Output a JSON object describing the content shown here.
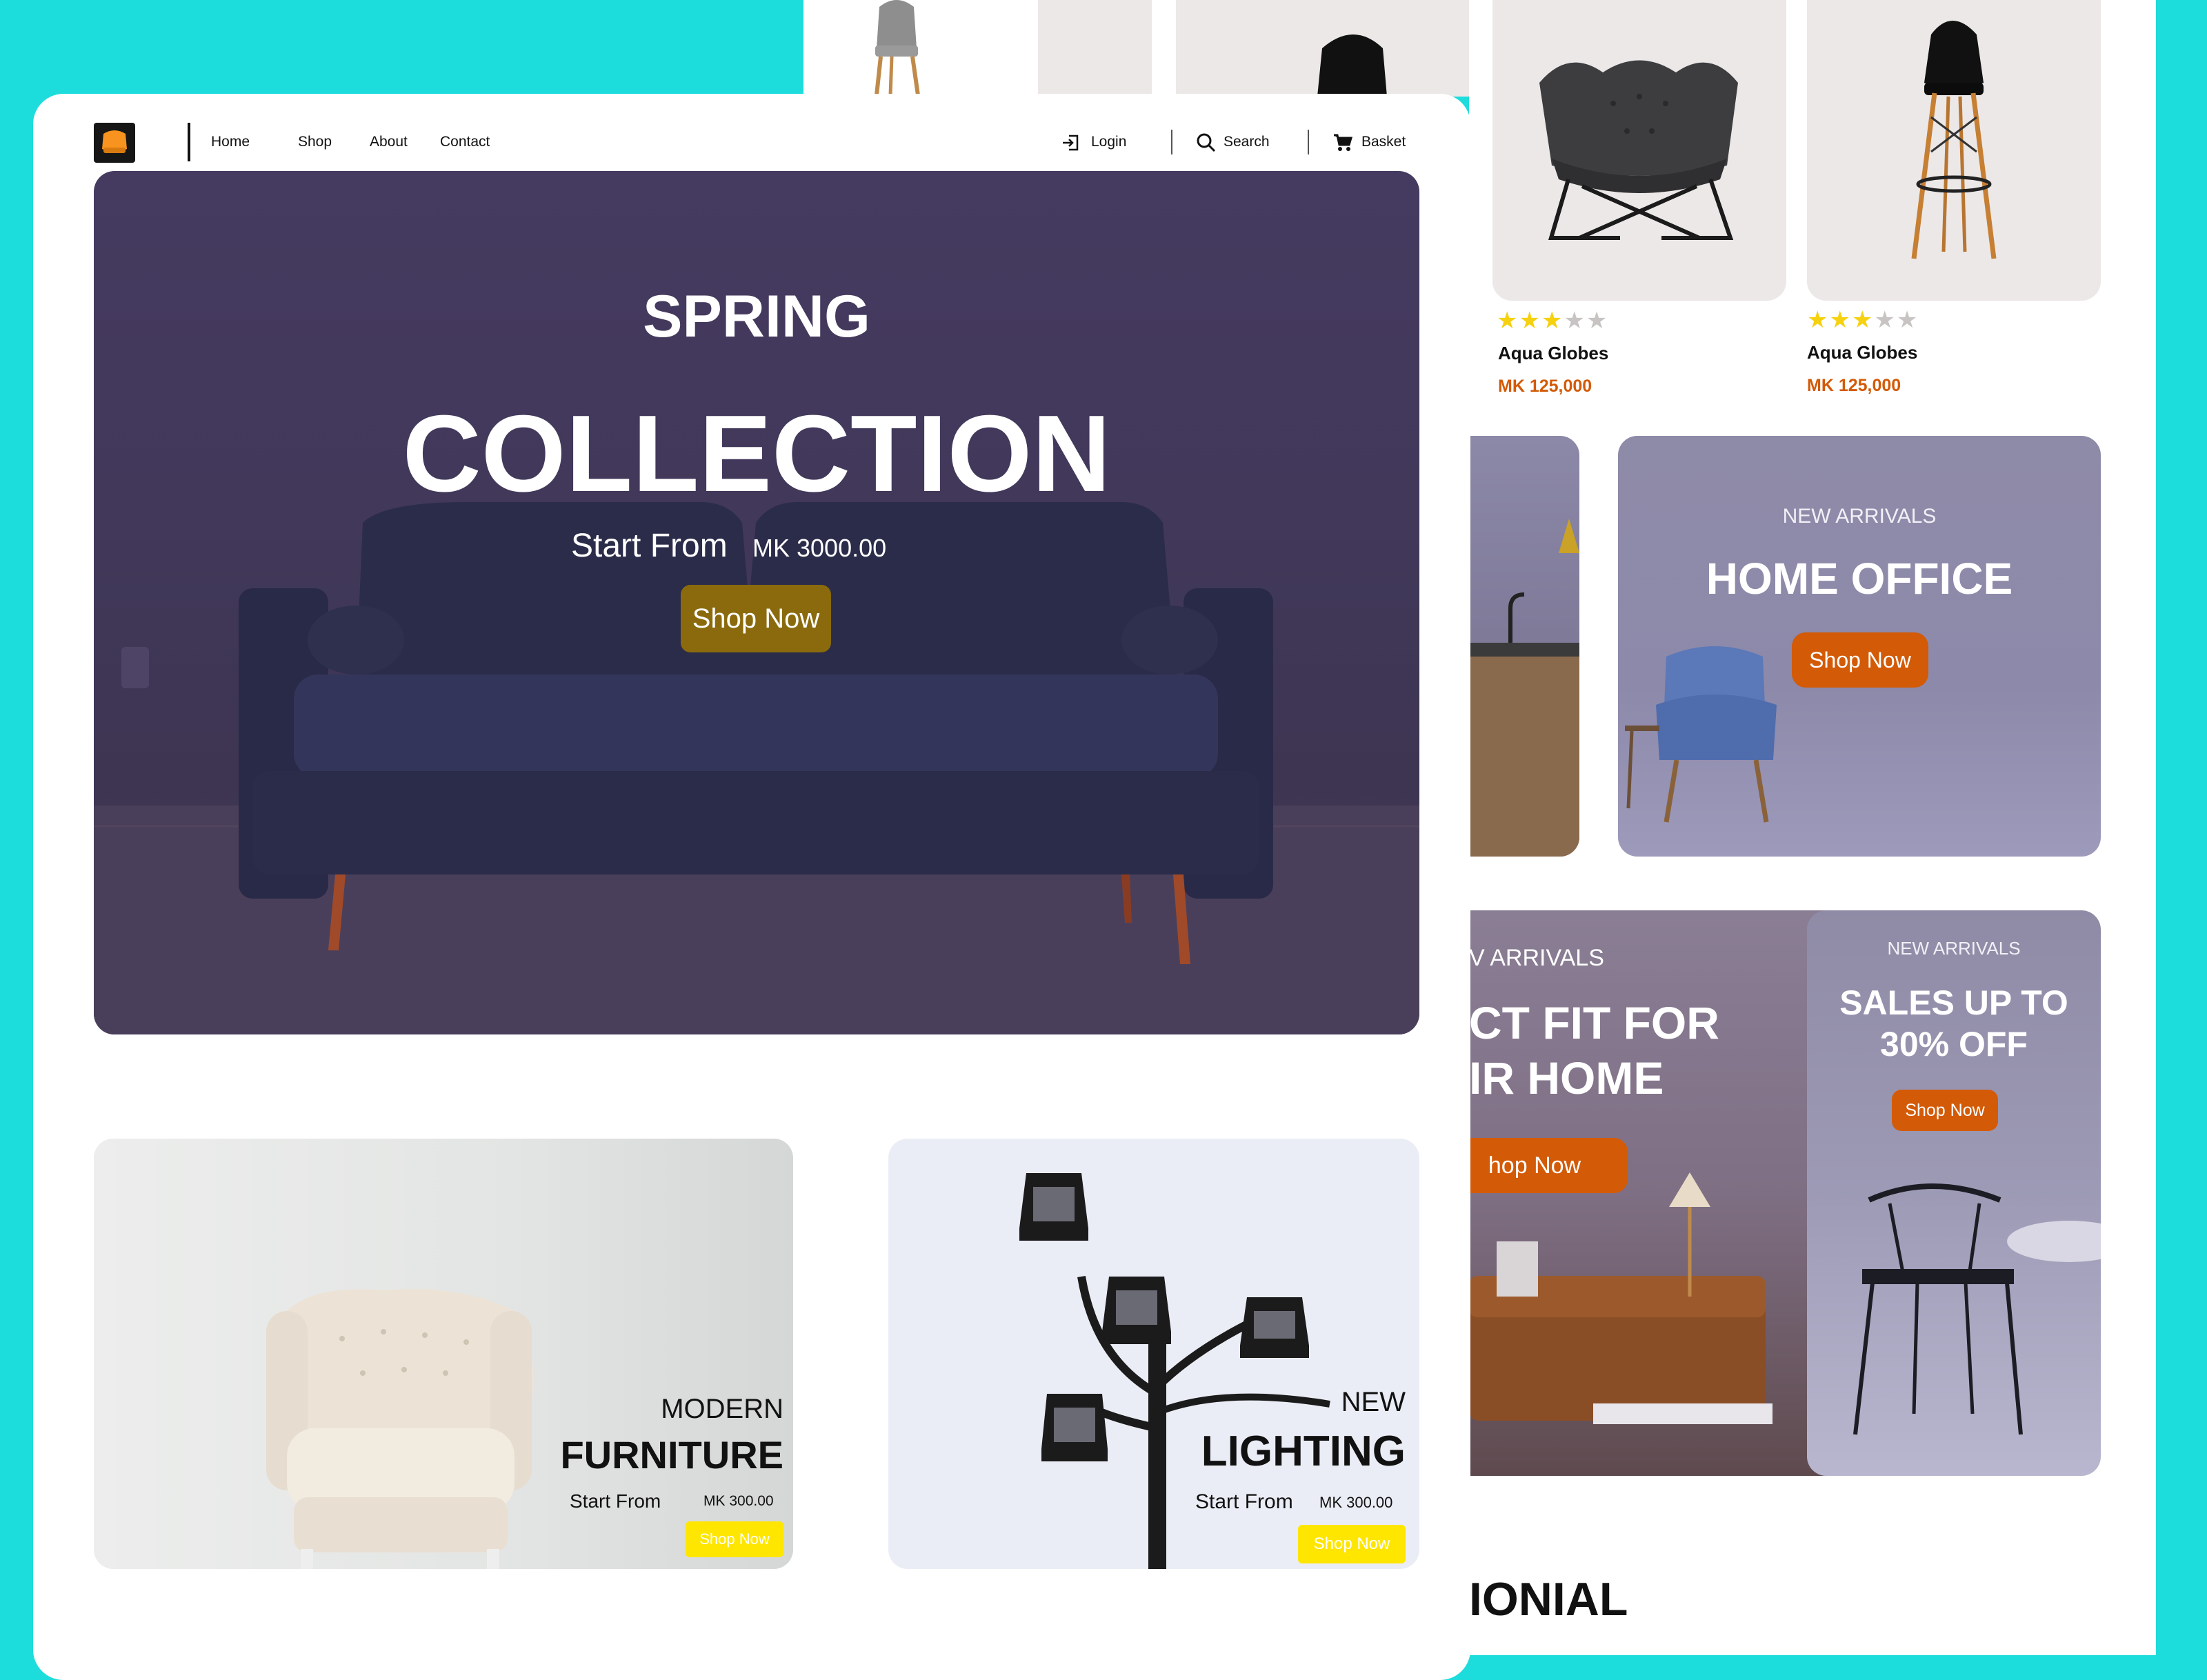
{
  "colors": {
    "background": "#1ddcdc",
    "hero_overlay": "#453a60",
    "hero_button": "#8a6a0d",
    "accent_orange": "#d35a07",
    "accent_yellow": "#ffe600",
    "price": "#d35a07",
    "star": "#f6d10f"
  },
  "nav": {
    "logo_icon": "armchair-logo-icon",
    "links": [
      "Home",
      "Shop",
      "About",
      "Contact"
    ],
    "login": "Login",
    "search": "Search",
    "basket": "Basket",
    "login_icon": "login-icon",
    "search_icon": "search-icon",
    "basket_icon": "cart-icon"
  },
  "hero": {
    "overline": "SPRING",
    "title": "COLLECTION",
    "start_from": "Start From",
    "price": "MK 3000.00",
    "button": "Shop Now"
  },
  "promos": [
    {
      "overline": "MODERN",
      "title": "FURNITURE",
      "start_from": "Start From",
      "price": "MK 300.00",
      "button": "Shop Now"
    },
    {
      "overline": "NEW",
      "title": "LIGHTING",
      "start_from": "Start From",
      "price": "MK 300.00",
      "button": "Shop Now"
    }
  ],
  "products": [
    {
      "name": "Aqua Globes",
      "price": "MK 125,000",
      "rating": 3,
      "max_rating": 5
    },
    {
      "name": "Aqua Globes",
      "price": "MK 125,000",
      "rating": 3,
      "max_rating": 5
    }
  ],
  "banners": {
    "home_office": {
      "overline": "NEW ARRIVALS",
      "title": "HOME OFFICE",
      "button": "Shop Now"
    },
    "perfect_fit": {
      "overline": "V ARRIVALS",
      "title_line1": "CT FIT FOR",
      "title_line2": "IR HOME",
      "button": "hop Now"
    },
    "sales": {
      "overline": "NEW ARRIVALS",
      "title_line1": "SALES UP TO",
      "title_line2": "30% OFF",
      "button": "Shop Now"
    }
  },
  "section_heading": "IONIAL"
}
